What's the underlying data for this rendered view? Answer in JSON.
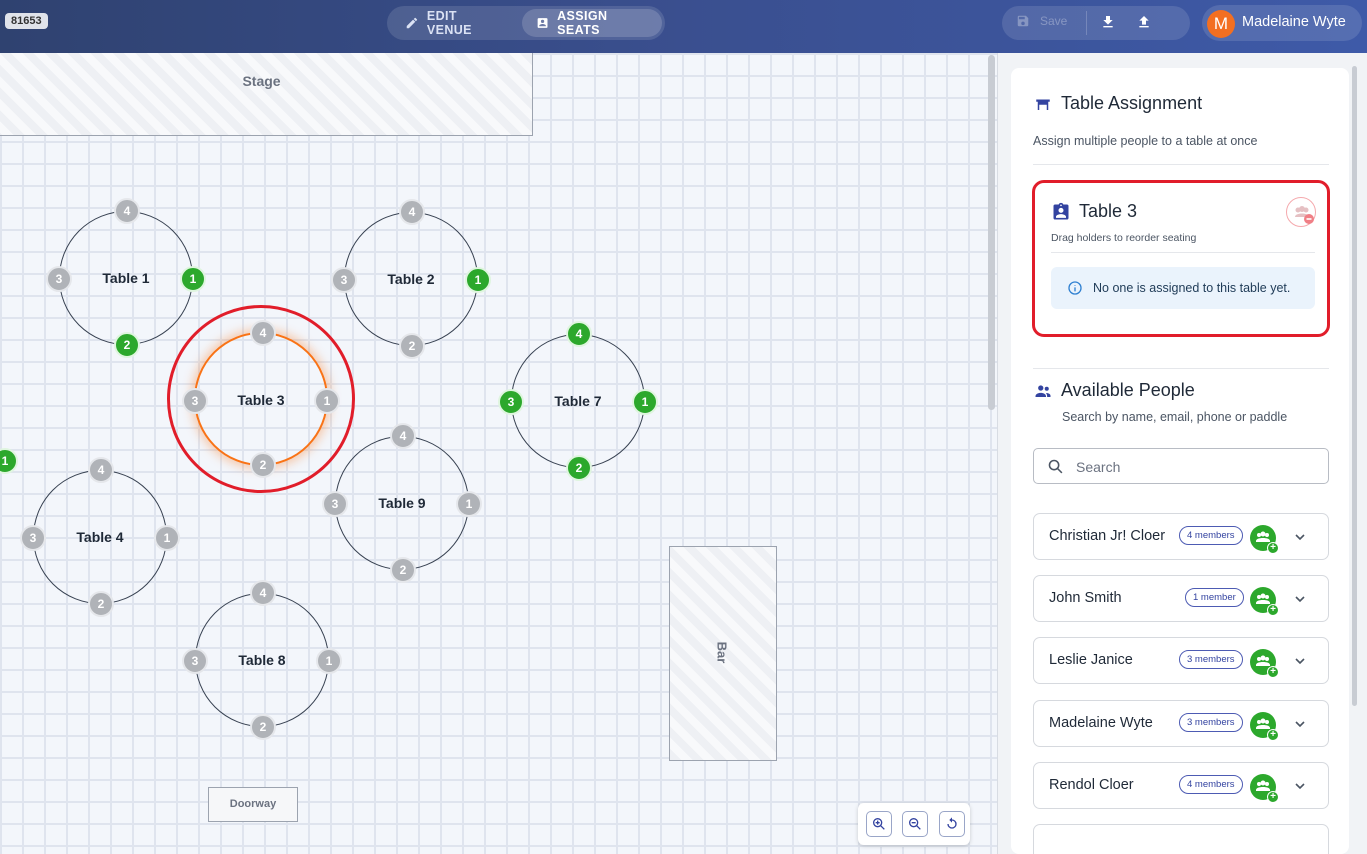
{
  "header": {
    "venue_id": "81653",
    "edit_venue_label": "EDIT VENUE",
    "assign_seats_label": "ASSIGN SEATS",
    "save_label": "Save",
    "user": {
      "initial": "M",
      "name": "Madelaine Wyte"
    }
  },
  "floor": {
    "stage_label": "Stage",
    "bar_label": "Bar",
    "doorway_label": "Doorway",
    "tables": [
      {
        "name": "Table 1",
        "seats": {
          "1": "taken",
          "2": "taken",
          "3": "free",
          "4": "free"
        }
      },
      {
        "name": "Table 2",
        "seats": {
          "1": "taken",
          "2": "free",
          "3": "free",
          "4": "free"
        }
      },
      {
        "name": "Table 3",
        "selected": true,
        "seats": {
          "1": "free",
          "2": "free",
          "3": "free",
          "4": "free"
        }
      },
      {
        "name": "Table 4",
        "seats": {
          "1": "free",
          "2": "free",
          "3": "free",
          "4": "free"
        }
      },
      {
        "name": "Table 7",
        "seats": {
          "1": "taken",
          "2": "taken",
          "3": "taken",
          "4": "taken"
        }
      },
      {
        "name": "Table 8",
        "seats": {
          "1": "free",
          "2": "free",
          "3": "free",
          "4": "free"
        }
      },
      {
        "name": "Table 9",
        "seats": {
          "1": "free",
          "2": "free",
          "3": "free",
          "4": "free"
        }
      }
    ],
    "partial_seat_label": "1"
  },
  "seat_labels": {
    "s1": "1",
    "s2": "2",
    "s3": "3",
    "s4": "4"
  },
  "sidebar": {
    "title": "Table Assignment",
    "subtitle": "Assign multiple people to a table at once",
    "selected_table": {
      "name": "Table 3",
      "hint": "Drag holders to reorder seating",
      "empty_message": "No one is assigned to this table yet."
    },
    "available": {
      "title": "Available People",
      "subtitle": "Search by name, email, phone or paddle",
      "search_placeholder": "Search",
      "search_value": "",
      "people": [
        {
          "name": "Christian Jr! Cloer",
          "members": "4 members"
        },
        {
          "name": "John Smith",
          "members": "1 member"
        },
        {
          "name": "Leslie Janice",
          "members": "3 members"
        },
        {
          "name": "Madelaine Wyte",
          "members": "3 members"
        },
        {
          "name": "Rendol Cloer",
          "members": "4 members"
        }
      ]
    }
  },
  "colors": {
    "taken_seat": "#2ca82c",
    "free_seat": "#b0b3b8",
    "selected_table": "#f97316",
    "highlight": "#e11d2a",
    "accent": "#3343a0"
  },
  "icons": {
    "edit": "pencil-icon",
    "assign": "badge-icon",
    "save": "floppy-icon",
    "download": "download-icon",
    "upload": "upload-icon",
    "zoom_in": "zoom-in-icon",
    "zoom_out": "zoom-out-icon",
    "reset": "reset-icon"
  }
}
